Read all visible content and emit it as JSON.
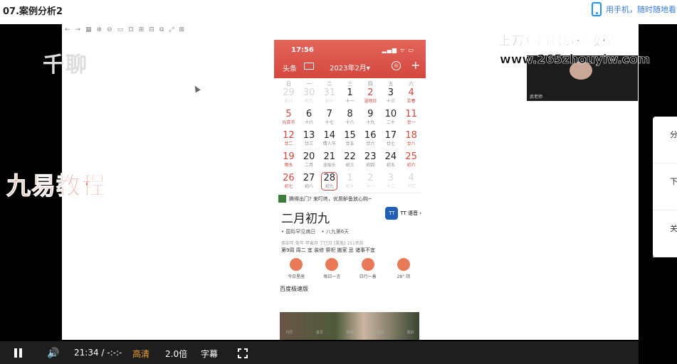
{
  "page_title": "07.案例分析2",
  "mobile_link": "用手机，随时随地看",
  "toolbar": [
    "←",
    "→",
    "▦",
    "⊕",
    "⊖",
    "▭",
    "⊡",
    "⊞",
    "⊟",
    "⧉",
    "⤢",
    "⊠"
  ],
  "watermarks": {
    "qianliao": "千聊",
    "jiuyi": "九易教程",
    "title": "上万套周易资料教程",
    "url": "www.265zhouyiw.com"
  },
  "webcam": {
    "name": "武老师"
  },
  "phone": {
    "time": "17:56",
    "signal": "▂▄▆ ᯤ ▭",
    "headline": "头条",
    "month": "2023年2月▾",
    "circle_icon": "◎",
    "plus": "+",
    "weekdays": [
      "日",
      "一",
      "二",
      "三",
      "四",
      "五",
      "六"
    ],
    "days": [
      {
        "n": "29",
        "l": "初八",
        "cls": "dim"
      },
      {
        "n": "30",
        "l": "初九",
        "cls": "dim"
      },
      {
        "n": "31",
        "l": "初十",
        "cls": "dim"
      },
      {
        "n": "1",
        "l": "十一",
        "cls": ""
      },
      {
        "n": "2",
        "l": "湿地日",
        "cls": "red"
      },
      {
        "n": "3",
        "l": "十三",
        "cls": ""
      },
      {
        "n": "4",
        "l": "立春",
        "cls": "red"
      },
      {
        "n": "5",
        "l": "元宵节",
        "cls": "red"
      },
      {
        "n": "6",
        "l": "十六",
        "cls": ""
      },
      {
        "n": "7",
        "l": "十七",
        "cls": ""
      },
      {
        "n": "8",
        "l": "十八",
        "cls": ""
      },
      {
        "n": "9",
        "l": "十九",
        "cls": ""
      },
      {
        "n": "10",
        "l": "二十",
        "cls": ""
      },
      {
        "n": "11",
        "l": "廿一",
        "cls": "red"
      },
      {
        "n": "12",
        "l": "廿二",
        "cls": "red"
      },
      {
        "n": "13",
        "l": "廿三",
        "cls": ""
      },
      {
        "n": "14",
        "l": "情人节",
        "cls": ""
      },
      {
        "n": "15",
        "l": "廿五",
        "cls": ""
      },
      {
        "n": "16",
        "l": "廿六",
        "cls": ""
      },
      {
        "n": "17",
        "l": "廿七",
        "cls": ""
      },
      {
        "n": "18",
        "l": "廿八",
        "cls": "red"
      },
      {
        "n": "19",
        "l": "雨水",
        "cls": "red"
      },
      {
        "n": "20",
        "l": "二月",
        "cls": ""
      },
      {
        "n": "21",
        "l": "龙抬头",
        "cls": ""
      },
      {
        "n": "22",
        "l": "初三",
        "cls": ""
      },
      {
        "n": "23",
        "l": "初四",
        "cls": ""
      },
      {
        "n": "24",
        "l": "初五",
        "cls": ""
      },
      {
        "n": "25",
        "l": "初六",
        "cls": "red"
      },
      {
        "n": "26",
        "l": "初七",
        "cls": "red"
      },
      {
        "n": "27",
        "l": "初八",
        "cls": ""
      },
      {
        "n": "28",
        "l": "初九",
        "cls": "sel"
      },
      {
        "n": "1",
        "l": "初十",
        "cls": "dim"
      },
      {
        "n": "2",
        "l": "十一",
        "cls": "dim"
      },
      {
        "n": "3",
        "l": "十二",
        "cls": "dim"
      },
      {
        "n": "4",
        "l": "十三",
        "cls": "dim"
      }
    ],
    "ad_text": "腾得出门? 来叮咚，优质鲈鱼放心购~",
    "lunar_big": "二月初九",
    "tt_label": "TT 语音 ›",
    "tt_logo": "TT",
    "festivals": [
      "• 国际罕见病日",
      "• 八九第6天"
    ],
    "detail": "癸卯年 兔年 甲寅月 丁巳日 [属兔]   151天前",
    "detail2": "第9周 周二   宜 装修 祭祀 搬家   忌 诸事不宜",
    "icon_labels": [
      "今日星座",
      "每日一言",
      "日行一善",
      "28° 阴"
    ],
    "news_title": "百度极速版",
    "tabs": [
      "日历",
      "首页",
      "视频",
      "发现",
      "我的"
    ]
  },
  "side_panel": [
    "分",
    "下",
    "关"
  ],
  "controls": {
    "time": "21:34 / -:-:-",
    "quality": "高清",
    "speed": "2.0倍",
    "subtitles": "字幕",
    "volume_icon": "🔊"
  }
}
